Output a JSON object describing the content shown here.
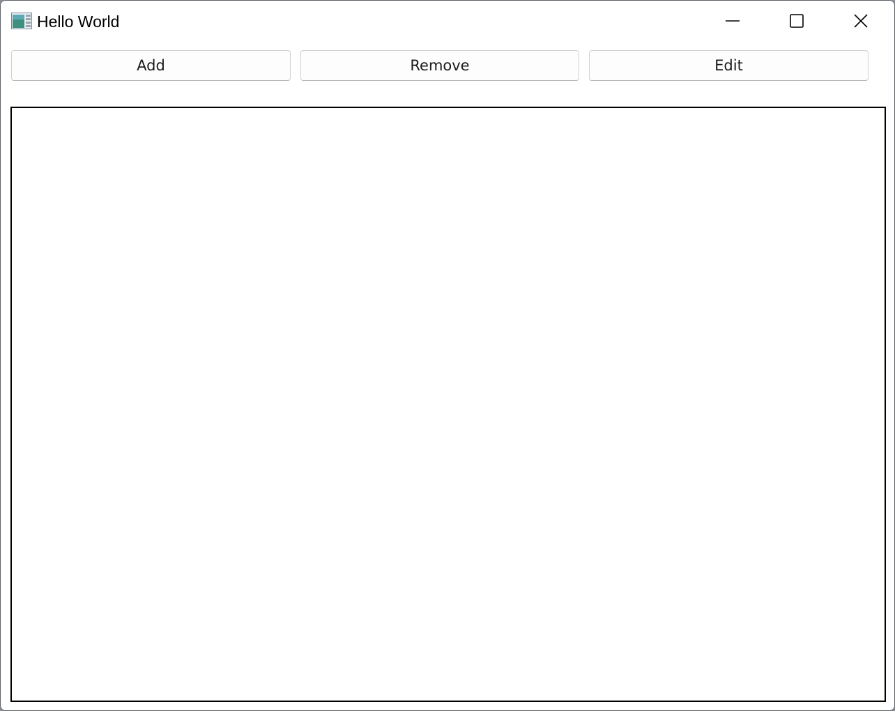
{
  "window": {
    "title": "Hello World",
    "app_icon": "app-window-icon"
  },
  "caption_buttons": {
    "minimize_icon": "minimize-icon",
    "maximize_icon": "maximize-icon",
    "close_icon": "close-icon"
  },
  "toolbar": {
    "add_label": "Add",
    "remove_label": "Remove",
    "edit_label": "Edit"
  },
  "colors": {
    "window_background": "#ffffff",
    "canvas_border": "#000000",
    "button_border": "#d0d0d0"
  }
}
